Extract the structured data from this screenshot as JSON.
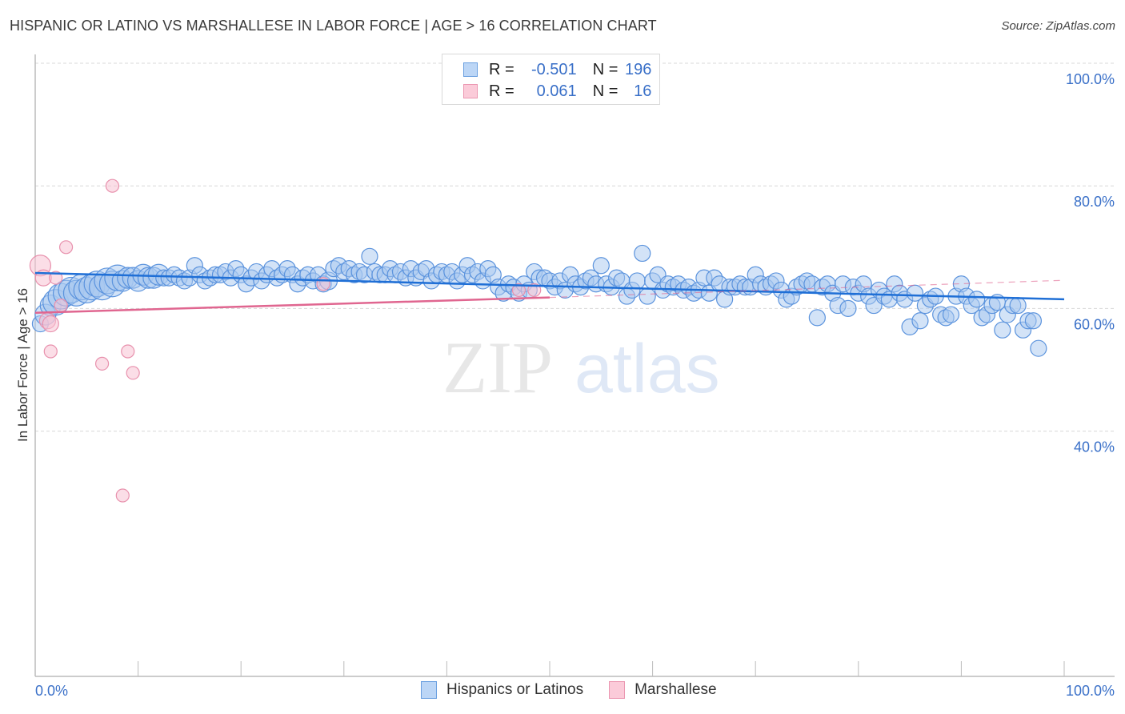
{
  "header": {
    "title": "HISPANIC OR LATINO VS MARSHALLESE IN LABOR FORCE | AGE > 16 CORRELATION CHART",
    "source": "Source: ZipAtlas.com"
  },
  "colors": {
    "blue_fill": "#a8c8f0",
    "blue_stroke": "#5b93dd",
    "blue_line": "#1f6fd6",
    "pink_fill": "#f8c2d3",
    "pink_stroke": "#e891ad",
    "pink_line": "#e06690",
    "axis_label": "#3a70c8",
    "grid": "#d8d8d8"
  },
  "legend_top": {
    "rows": [
      {
        "series": "Hispanics or Latinos",
        "r_label": "R = ",
        "r_value": "-0.501",
        "n_label": "N = ",
        "n_value": "196"
      },
      {
        "series": "Marshallese",
        "r_label": "R = ",
        "r_value": " 0.061",
        "n_label": "N = ",
        "n_value": "16"
      }
    ]
  },
  "watermark": {
    "zip": "ZIP",
    "atlas": "atlas"
  },
  "chart_data": {
    "type": "scatter",
    "title": "HISPANIC OR LATINO VS MARSHALLESE IN LABOR FORCE | AGE > 16 CORRELATION CHART",
    "xlabel": "",
    "ylabel": "In Labor Force | Age > 16",
    "xlim": [
      0,
      100
    ],
    "ylim": [
      0,
      100
    ],
    "x_tick_labels": [
      "0.0%",
      "100.0%"
    ],
    "y_ticks": [
      40,
      60,
      80,
      100
    ],
    "y_tick_labels": [
      "40.0%",
      "60.0%",
      "80.0%",
      "100.0%"
    ],
    "grid": true,
    "legend_position": "bottom-center",
    "legend": [
      "Hispanics or Latinos",
      "Marshallese"
    ],
    "series": [
      {
        "name": "Hispanics or Latinos",
        "r": -0.501,
        "n": 196,
        "trend": {
          "x": [
            0,
            100
          ],
          "y": [
            65.8,
            61.5
          ]
        },
        "points": [
          [
            0.5,
            57.5,
            2
          ],
          [
            1,
            59,
            3
          ],
          [
            1.5,
            60.5,
            3
          ],
          [
            2,
            61,
            4
          ],
          [
            2.5,
            62,
            4
          ],
          [
            3,
            62.5,
            4
          ],
          [
            3.5,
            63,
            4
          ],
          [
            4,
            62.5,
            4
          ],
          [
            4.5,
            63.5,
            4
          ],
          [
            5,
            63,
            4
          ],
          [
            5.5,
            63.5,
            4
          ],
          [
            6,
            64,
            4
          ],
          [
            6.5,
            63.5,
            4
          ],
          [
            7,
            64.5,
            4
          ],
          [
            7.5,
            64,
            4
          ],
          [
            8,
            65,
            4
          ],
          [
            8.5,
            64.5,
            3
          ],
          [
            9,
            65,
            3
          ],
          [
            9.5,
            65,
            3
          ],
          [
            10,
            64.5,
            3
          ],
          [
            10.5,
            65.5,
            3
          ],
          [
            11,
            65,
            3
          ],
          [
            11.5,
            65,
            3
          ],
          [
            12,
            65.5,
            3
          ],
          [
            12.5,
            65,
            2
          ],
          [
            13,
            65,
            2
          ],
          [
            13.5,
            65.5,
            2
          ],
          [
            14,
            65,
            2
          ],
          [
            14.5,
            64.5,
            2
          ],
          [
            15,
            65,
            2
          ],
          [
            15.5,
            67,
            2
          ],
          [
            16,
            65.5,
            2
          ],
          [
            16.5,
            64.5,
            2
          ],
          [
            17,
            65,
            2
          ],
          [
            17.5,
            65.5,
            2
          ],
          [
            18,
            65.5,
            2
          ],
          [
            18.5,
            66,
            2
          ],
          [
            19,
            65,
            2
          ],
          [
            19.5,
            66.5,
            2
          ],
          [
            20,
            65.5,
            2
          ],
          [
            20.5,
            64,
            2
          ],
          [
            21,
            65,
            2
          ],
          [
            21.5,
            66,
            2
          ],
          [
            22,
            64.5,
            2
          ],
          [
            22.5,
            65.5,
            2
          ],
          [
            23,
            66.5,
            2
          ],
          [
            23.5,
            65,
            2
          ],
          [
            24,
            65.5,
            2
          ],
          [
            24.5,
            66.5,
            2
          ],
          [
            25,
            65.5,
            2
          ],
          [
            25.5,
            64,
            2
          ],
          [
            26,
            65,
            2
          ],
          [
            26.5,
            65.5,
            2
          ],
          [
            27,
            64.5,
            2
          ],
          [
            27.5,
            65.5,
            2
          ],
          [
            28,
            64,
            2
          ],
          [
            28.5,
            64.5,
            2.5
          ],
          [
            29,
            66.5,
            2
          ],
          [
            29.5,
            67,
            2
          ],
          [
            30,
            66,
            2
          ],
          [
            30.5,
            66.5,
            2
          ],
          [
            31,
            65.5,
            2
          ],
          [
            31.5,
            66,
            2
          ],
          [
            32,
            65.5,
            2
          ],
          [
            32.5,
            68.5,
            2
          ],
          [
            33,
            66,
            2
          ],
          [
            33.5,
            65.5,
            2
          ],
          [
            34,
            65.5,
            2
          ],
          [
            34.5,
            66.5,
            2
          ],
          [
            35,
            65.5,
            2
          ],
          [
            35.5,
            66,
            2
          ],
          [
            36,
            65,
            2
          ],
          [
            36.5,
            66.5,
            2
          ],
          [
            37,
            65,
            2
          ],
          [
            37.5,
            66,
            2
          ],
          [
            38,
            66.5,
            2
          ],
          [
            38.5,
            64.5,
            2
          ],
          [
            39,
            65.5,
            2
          ],
          [
            39.5,
            66,
            2
          ],
          [
            40,
            65.5,
            2
          ],
          [
            40.5,
            66,
            2
          ],
          [
            41,
            64.5,
            2
          ],
          [
            41.5,
            65.5,
            2
          ],
          [
            42,
            67,
            2
          ],
          [
            42.5,
            65.5,
            2
          ],
          [
            43,
            66,
            2
          ],
          [
            43.5,
            64.5,
            2
          ],
          [
            44,
            66.5,
            2
          ],
          [
            44.5,
            65.5,
            2
          ],
          [
            45,
            63.5,
            2
          ],
          [
            45.5,
            62.5,
            2
          ],
          [
            46,
            64,
            2
          ],
          [
            46.5,
            63.5,
            2
          ],
          [
            47,
            62.5,
            2
          ],
          [
            47.5,
            64,
            2
          ],
          [
            48,
            63,
            2
          ],
          [
            48.5,
            66,
            2
          ],
          [
            49,
            65,
            2
          ],
          [
            49.5,
            65,
            2
          ],
          [
            50,
            64.5,
            2
          ],
          [
            50.5,
            63.5,
            2
          ],
          [
            51,
            64.5,
            2
          ],
          [
            51.5,
            63,
            2
          ],
          [
            52,
            65.5,
            2
          ],
          [
            52.5,
            64,
            2
          ],
          [
            53,
            63.5,
            2
          ],
          [
            53.5,
            64.5,
            2
          ],
          [
            54,
            65,
            2
          ],
          [
            54.5,
            64,
            2
          ],
          [
            55,
            67,
            2
          ],
          [
            55.5,
            64,
            2
          ],
          [
            56,
            63.5,
            2
          ],
          [
            56.5,
            65,
            2
          ],
          [
            57,
            64.5,
            2
          ],
          [
            57.5,
            62,
            2
          ],
          [
            58,
            63,
            2
          ],
          [
            58.5,
            64.5,
            2
          ],
          [
            59,
            69,
            2
          ],
          [
            59.5,
            62,
            2
          ],
          [
            60,
            64.5,
            2
          ],
          [
            60.5,
            65.5,
            2
          ],
          [
            61,
            63,
            2
          ],
          [
            61.5,
            64,
            2
          ],
          [
            62,
            63.5,
            2
          ],
          [
            62.5,
            64,
            2
          ],
          [
            63,
            63,
            2
          ],
          [
            63.5,
            63.5,
            2
          ],
          [
            64,
            62.5,
            2
          ],
          [
            64.5,
            63,
            2
          ],
          [
            65,
            65,
            2
          ],
          [
            65.5,
            62.5,
            2
          ],
          [
            66,
            65,
            2
          ],
          [
            66.5,
            64,
            2
          ],
          [
            67,
            61.5,
            2
          ],
          [
            67.5,
            63.5,
            2
          ],
          [
            68,
            63.5,
            2
          ],
          [
            68.5,
            64,
            2
          ],
          [
            69,
            63.5,
            2
          ],
          [
            69.5,
            63.5,
            2
          ],
          [
            70,
            65.5,
            2
          ],
          [
            70.5,
            64,
            2
          ],
          [
            71,
            63.5,
            2
          ],
          [
            71.5,
            64,
            2
          ],
          [
            72,
            64.5,
            2
          ],
          [
            72.5,
            63,
            2
          ],
          [
            73,
            61.5,
            2
          ],
          [
            73.5,
            62,
            2
          ],
          [
            74,
            63.5,
            2
          ],
          [
            74.5,
            64,
            2
          ],
          [
            75,
            64.5,
            2
          ],
          [
            75.5,
            64,
            2
          ],
          [
            76,
            58.5,
            2
          ],
          [
            76.5,
            63.5,
            2
          ],
          [
            77,
            64,
            2
          ],
          [
            77.5,
            62.5,
            2
          ],
          [
            78,
            60.5,
            2
          ],
          [
            78.5,
            64,
            2
          ],
          [
            79,
            60,
            2
          ],
          [
            79.5,
            63.5,
            2
          ],
          [
            80,
            62.5,
            2
          ],
          [
            80.5,
            64,
            2
          ],
          [
            81,
            62,
            2
          ],
          [
            81.5,
            60.5,
            2
          ],
          [
            82,
            63,
            2
          ],
          [
            82.5,
            62,
            2
          ],
          [
            83,
            61.5,
            2
          ],
          [
            83.5,
            64,
            2
          ],
          [
            84,
            62.5,
            2
          ],
          [
            84.5,
            61.5,
            2
          ],
          [
            85,
            57,
            2
          ],
          [
            85.5,
            62.5,
            2
          ],
          [
            86,
            58,
            2
          ],
          [
            86.5,
            60.5,
            2
          ],
          [
            87,
            61.5,
            2
          ],
          [
            87.5,
            62,
            2
          ],
          [
            88,
            59,
            2
          ],
          [
            88.5,
            58.5,
            2
          ],
          [
            89,
            59,
            2
          ],
          [
            89.5,
            62,
            2
          ],
          [
            90,
            64,
            2
          ],
          [
            90.5,
            62,
            2
          ],
          [
            91,
            60.5,
            2
          ],
          [
            91.5,
            61.5,
            2
          ],
          [
            92,
            58.5,
            2
          ],
          [
            92.5,
            59,
            2
          ],
          [
            93,
            60.5,
            2
          ],
          [
            93.5,
            61,
            2
          ],
          [
            94,
            56.5,
            2
          ],
          [
            94.5,
            59,
            2
          ],
          [
            95,
            60.5,
            2
          ],
          [
            95.5,
            60.5,
            2
          ],
          [
            96,
            56.5,
            2
          ],
          [
            96.5,
            58,
            2
          ],
          [
            97,
            58,
            2
          ],
          [
            97.5,
            53.5,
            2
          ]
        ]
      },
      {
        "name": "Marshallese",
        "r": 0.061,
        "n": 16,
        "trend": {
          "x": [
            0,
            50,
            100
          ],
          "y": [
            59.3,
            61.8,
            64.6
          ],
          "solid_until": 50
        },
        "points": [
          [
            0.5,
            67,
            3
          ],
          [
            0.8,
            65,
            2
          ],
          [
            1.2,
            58,
            2
          ],
          [
            1.5,
            57.5,
            2
          ],
          [
            1.5,
            53,
            1.5
          ],
          [
            2,
            65,
            1.5
          ],
          [
            2.5,
            60.5,
            1.5
          ],
          [
            3,
            70,
            1.5
          ],
          [
            6.5,
            51,
            1.5
          ],
          [
            7.5,
            80,
            1.5
          ],
          [
            8.5,
            29.5,
            1.5
          ],
          [
            9,
            53,
            1.5
          ],
          [
            9.5,
            49.5,
            1.5
          ],
          [
            28,
            64,
            1.5
          ],
          [
            47,
            63,
            1.5
          ],
          [
            48.5,
            63,
            1.5
          ]
        ]
      }
    ]
  },
  "bottom_legend": {
    "items": [
      {
        "label": "Hispanics or Latinos"
      },
      {
        "label": "Marshallese"
      }
    ]
  }
}
